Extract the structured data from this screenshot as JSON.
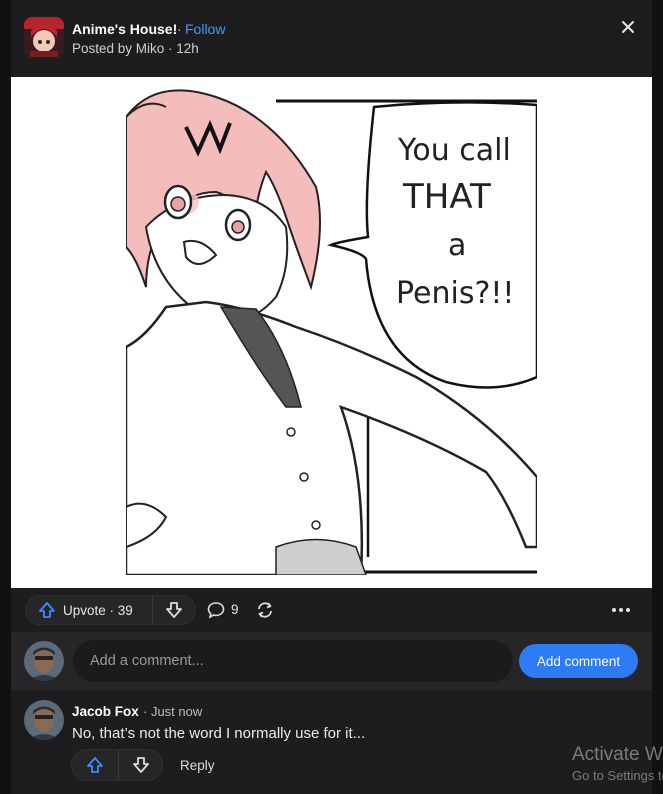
{
  "header": {
    "space_name": "Anime's House!",
    "separator": "·",
    "follow_label": "Follow",
    "posted_by": "Posted by Miko · 12h",
    "close_icon": "close-icon"
  },
  "image": {
    "speech_lines": [
      "You call",
      "THAT",
      "a",
      "Penis?!!"
    ]
  },
  "actions": {
    "upvote_label": "Upvote · 39",
    "comment_count": "9",
    "icons": [
      "upvote-arrow-icon",
      "downvote-arrow-icon",
      "comment-bubble-icon",
      "share-reshare-icon",
      "more-dots-icon"
    ]
  },
  "comment_box": {
    "placeholder": "Add a comment...",
    "submit_label": "Add comment"
  },
  "comments": [
    {
      "author": "Jacob Fox",
      "time": "· Just now",
      "text": "No, that’s not the word I normally use for it...",
      "reply_label": "Reply"
    }
  ],
  "watermark": {
    "title": "Activate Windows",
    "subtitle": "Go to Settings to activate Windows."
  },
  "colors": {
    "background": "#1d1d1f",
    "accent": "#2e7bf6",
    "link": "#3b9bff",
    "upvote_blue": "#3b8cff"
  }
}
